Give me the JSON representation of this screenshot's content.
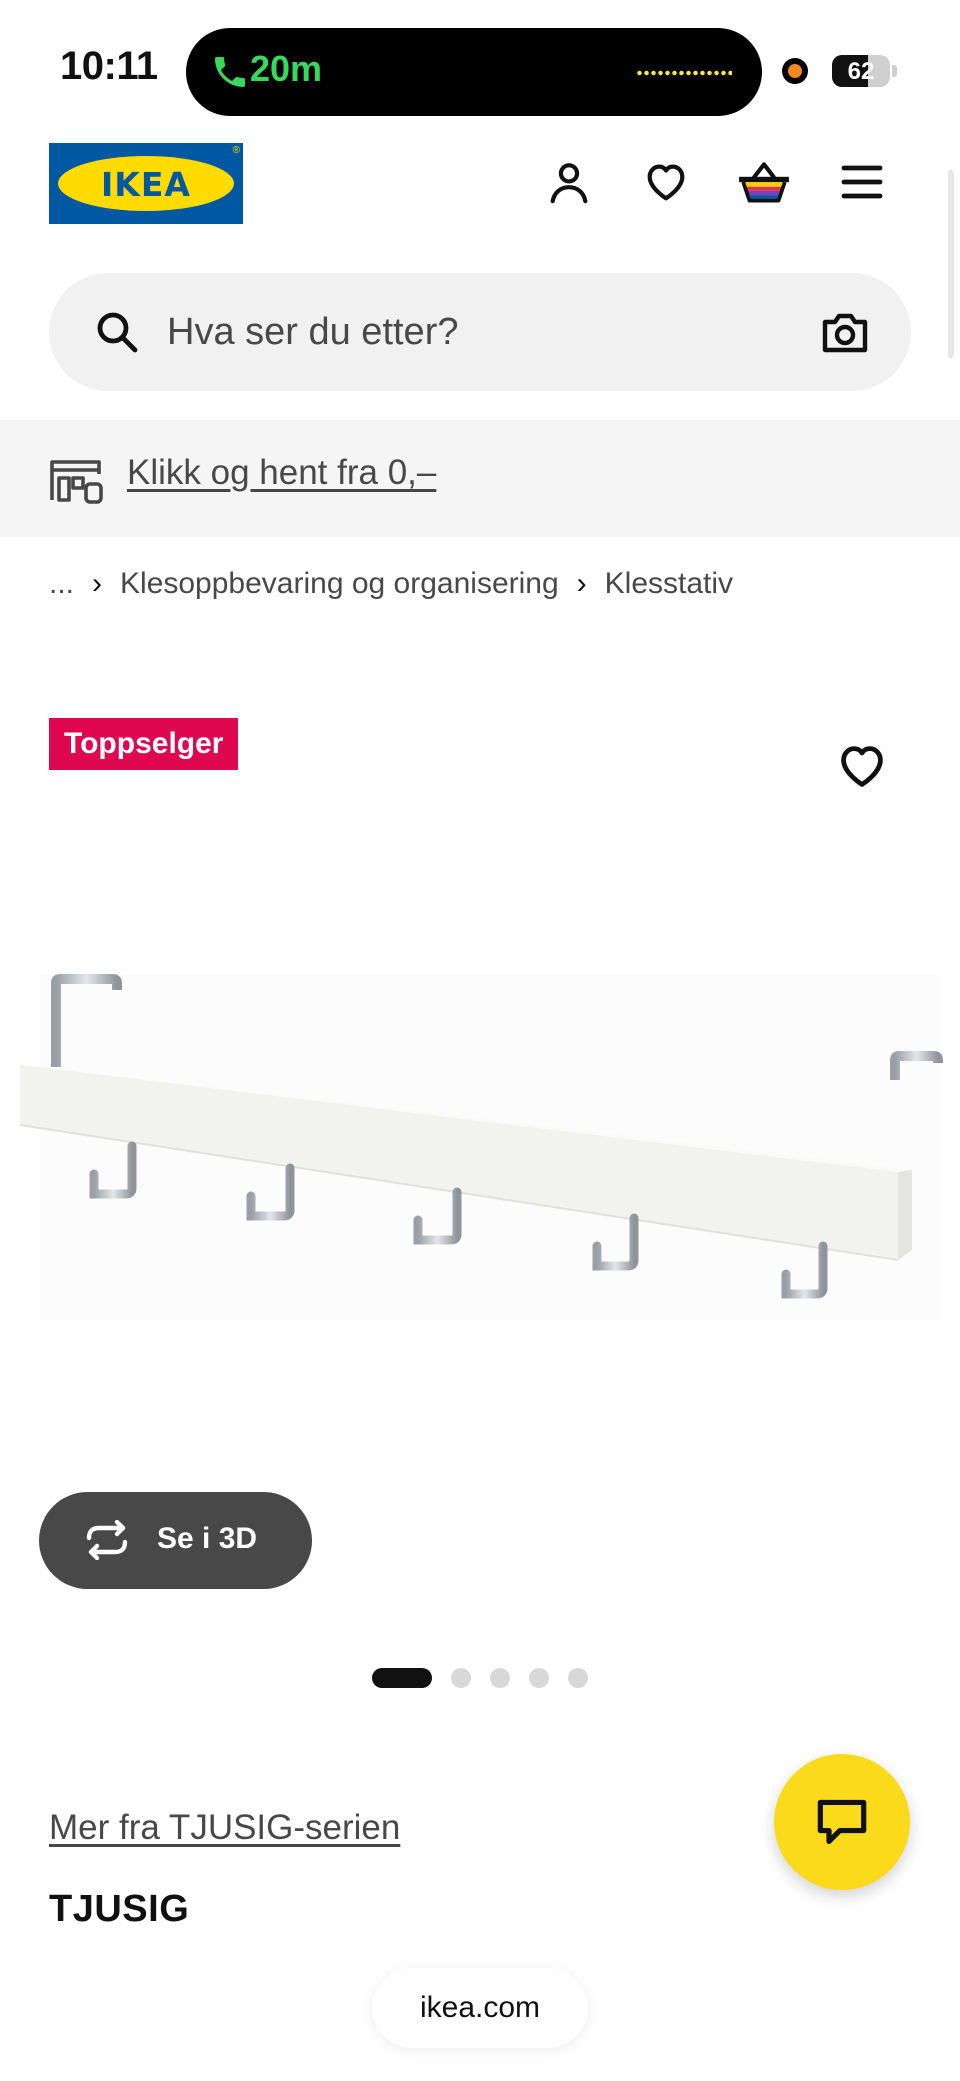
{
  "status_bar": {
    "time": "10:11",
    "call_duration": "20m",
    "battery_level": "62",
    "battery_percent": 62,
    "call_color": "#37d85c",
    "recording_dot_color": "#f08a1f"
  },
  "header": {
    "logo_text": "IKEA",
    "logo_colors": {
      "blue": "#0058a3",
      "yellow": "#ffdb00"
    },
    "icons": [
      "profile-icon",
      "heart-icon",
      "shopping-bag-icon",
      "menu-icon"
    ]
  },
  "search": {
    "placeholder": "Hva ser du etter?",
    "icon": "search-icon",
    "camera_icon": "camera-icon"
  },
  "banner": {
    "link_text": "Klikk og hent fra 0,–",
    "icon": "store-pickup-icon"
  },
  "breadcrumb": {
    "ellipsis": "...",
    "items": [
      "Klesoppbevaring og organisering",
      "Klesstativ"
    ]
  },
  "product": {
    "badge": "Toppselger",
    "badge_color": "#e00751",
    "view_3d_label": "Se i 3D",
    "image_count": 5,
    "active_image_index": 0,
    "series_link": "Mer fra TJUSIG-serien",
    "name": "TJUSIG"
  },
  "chat": {
    "icon": "chat-icon",
    "color": "#fada1a"
  },
  "browser": {
    "url": "ikea.com"
  }
}
